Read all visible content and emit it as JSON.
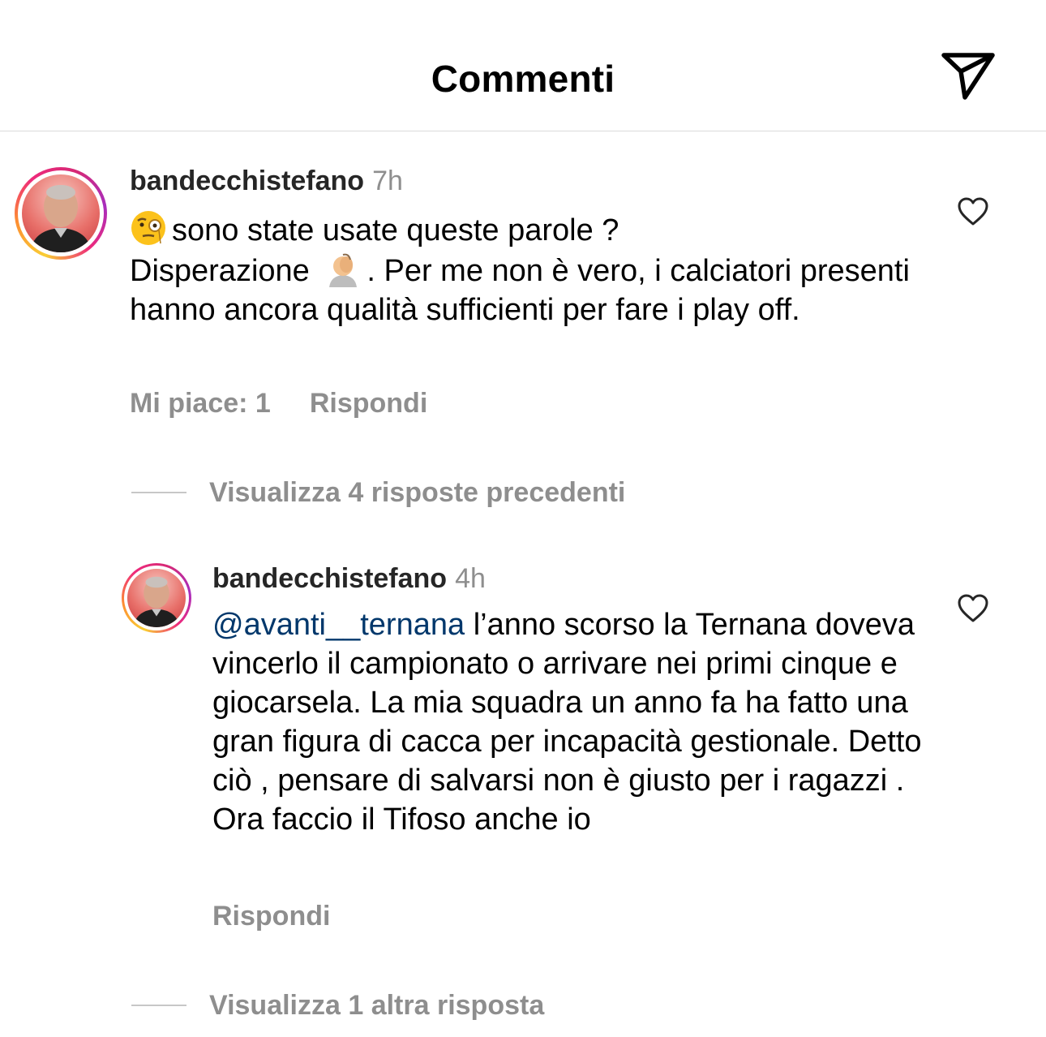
{
  "header": {
    "title": "Commenti"
  },
  "comments": [
    {
      "username": "bandecchistefano",
      "time": "7h",
      "emoji_1": "face-with-monocle-emoji",
      "text_1": "sono state usate queste parole ?",
      "text_2": "Disperazione",
      "emoji_2": "face-palm-emoji",
      "text_3": ". Per me non è vero, i calciatori presenti hanno ancora qualità sufficienti per fare i play off.",
      "likes_label": "Mi piace: 1",
      "reply_label": "Rispondi"
    }
  ],
  "replies_toggle_1": "Visualizza 4 risposte precedenti",
  "reply": {
    "username": "bandecchistefano",
    "time": "4h",
    "mention": "@avanti__ternana",
    "text": "l’anno scorso la Ternana doveva vincerlo il campionato o arrivare nei primi cinque e giocarsela. La mia squadra un anno fa ha fatto una gran figura di cacca per incapacità gestionale. Detto ciò , pensare di salvarsi non è giusto per i ragazzi . Ora faccio il Tifoso anche io",
    "reply_label": "Rispondi"
  },
  "replies_toggle_2": "Visualizza 1 altra risposta",
  "icons": {
    "send": "send-icon",
    "heart": "heart-outline-icon"
  }
}
